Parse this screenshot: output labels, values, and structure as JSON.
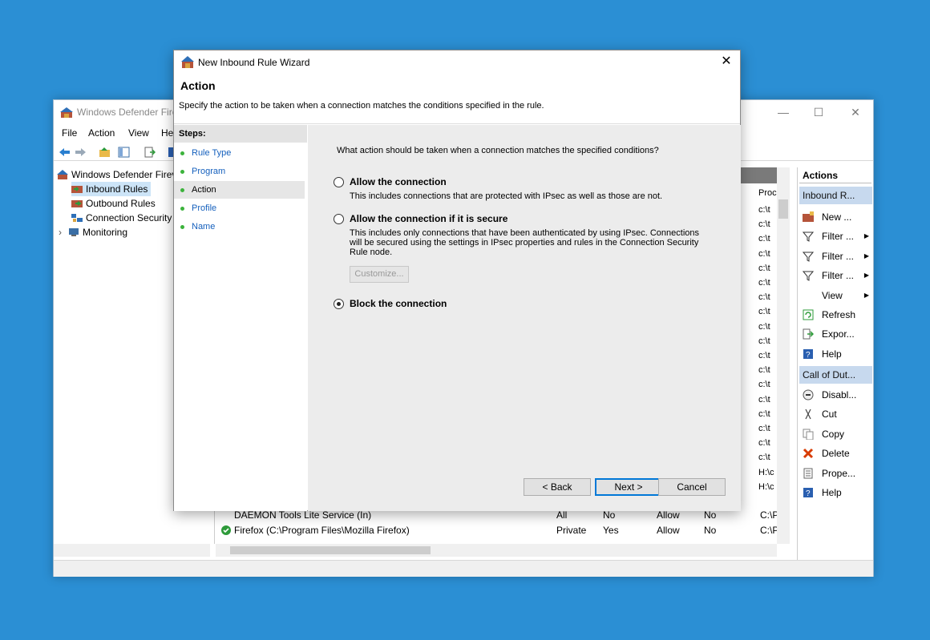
{
  "main_window": {
    "title": "Windows Defender Fire",
    "controls": {
      "minimize": "—",
      "maximize": "☐",
      "close": "✕"
    },
    "menu": [
      "File",
      "Action",
      "View",
      "He"
    ],
    "tree": [
      {
        "label": "Windows Defender Firev"
      },
      {
        "label": "Inbound Rules"
      },
      {
        "label": "Outbound Rules"
      },
      {
        "label": "Connection Security"
      },
      {
        "label": "Monitoring"
      }
    ],
    "list": {
      "program_header": "Proc",
      "program_column": [
        "c:\\t",
        "c:\\t",
        "c:\\t",
        "c:\\t",
        "c:\\t",
        "c:\\t",
        "c:\\t",
        "c:\\t",
        "c:\\t",
        "c:\\t",
        "c:\\t",
        "c:\\t",
        "c:\\t",
        "c:\\t",
        "c:\\t",
        "c:\\t",
        "c:\\t",
        "c:\\t",
        "H:\\c",
        "H:\\c"
      ],
      "rows": [
        {
          "name": "DAEMON Tools Lite Service (In)",
          "profile": "All",
          "enabled": "No",
          "action": "Allow",
          "override": "No",
          "program": "C:\\P"
        },
        {
          "name": "Firefox (C:\\Program Files\\Mozilla Firefox)",
          "profile": "Private",
          "enabled": "Yes",
          "action": "Allow",
          "override": "No",
          "program": "C:\\P"
        }
      ]
    },
    "actions": {
      "title": "Actions",
      "section1": "Inbound R...",
      "section1_items": [
        {
          "label": "New ...",
          "icon": "new-rule-icon"
        },
        {
          "label": "Filter ...",
          "icon": "filter-icon",
          "submenu": true
        },
        {
          "label": "Filter ...",
          "icon": "filter-icon",
          "submenu": true
        },
        {
          "label": "Filter ...",
          "icon": "filter-icon",
          "submenu": true
        },
        {
          "label": "View",
          "icon": "",
          "submenu": true
        },
        {
          "label": "Refresh",
          "icon": "refresh-icon"
        },
        {
          "label": "Expor...",
          "icon": "export-icon"
        },
        {
          "label": "Help",
          "icon": "help-icon"
        }
      ],
      "section2": "Call of Dut...",
      "section2_items": [
        {
          "label": "Disabl...",
          "icon": "disable-icon"
        },
        {
          "label": "Cut",
          "icon": "cut-icon"
        },
        {
          "label": "Copy",
          "icon": "copy-icon"
        },
        {
          "label": "Delete",
          "icon": "delete-icon"
        },
        {
          "label": "Prope...",
          "icon": "properties-icon"
        },
        {
          "label": "Help",
          "icon": "help-icon"
        }
      ]
    }
  },
  "wizard": {
    "title": "New Inbound Rule Wizard",
    "close": "✕",
    "heading": "Action",
    "subheading": "Specify the action to be taken when a connection matches the conditions specified in the rule.",
    "steps_title": "Steps:",
    "steps": [
      "Rule Type",
      "Program",
      "Action",
      "Profile",
      "Name"
    ],
    "active_step": "Action",
    "question": "What action should be taken when a connection matches the specified conditions?",
    "options": [
      {
        "label": "Allow the connection",
        "description": "This includes connections that are protected with IPsec as well as those are not.",
        "checked": false
      },
      {
        "label": "Allow the connection if it is secure",
        "description": "This includes only connections that have been authenticated by using IPsec.  Connections will be secured using the settings in IPsec properties and rules in the Connection Security Rule node.",
        "checked": false
      },
      {
        "label": "Block the connection",
        "description": "",
        "checked": true
      }
    ],
    "customize_button": "Customize...",
    "back_button": "< Back",
    "next_button": "Next >",
    "cancel_button": "Cancel"
  }
}
